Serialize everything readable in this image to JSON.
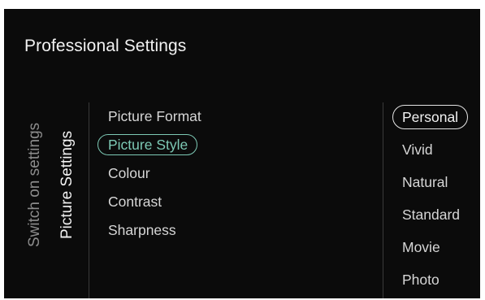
{
  "header": {
    "title": "Professional Settings"
  },
  "side_tabs": [
    {
      "label": "Switch on settings",
      "active": false
    },
    {
      "label": "Picture Settings",
      "active": true
    }
  ],
  "menu": {
    "items": [
      {
        "label": "Picture Format",
        "selected": false
      },
      {
        "label": "Picture Style",
        "selected": true
      },
      {
        "label": "Colour",
        "selected": false
      },
      {
        "label": "Contrast",
        "selected": false
      },
      {
        "label": "Sharpness",
        "selected": false
      }
    ]
  },
  "options": {
    "items": [
      {
        "label": "Personal",
        "selected": true
      },
      {
        "label": "Vivid",
        "selected": false
      },
      {
        "label": "Natural",
        "selected": false
      },
      {
        "label": "Standard",
        "selected": false
      },
      {
        "label": "Movie",
        "selected": false
      },
      {
        "label": "Photo",
        "selected": false
      }
    ]
  },
  "colors": {
    "background": "#0b0b0b",
    "text": "#d6d6d6",
    "title": "#f2f2f2",
    "inactive_tab": "#8c8c8c",
    "accent_teal": "#7dc9b5",
    "divider": "#3a3a3a"
  }
}
